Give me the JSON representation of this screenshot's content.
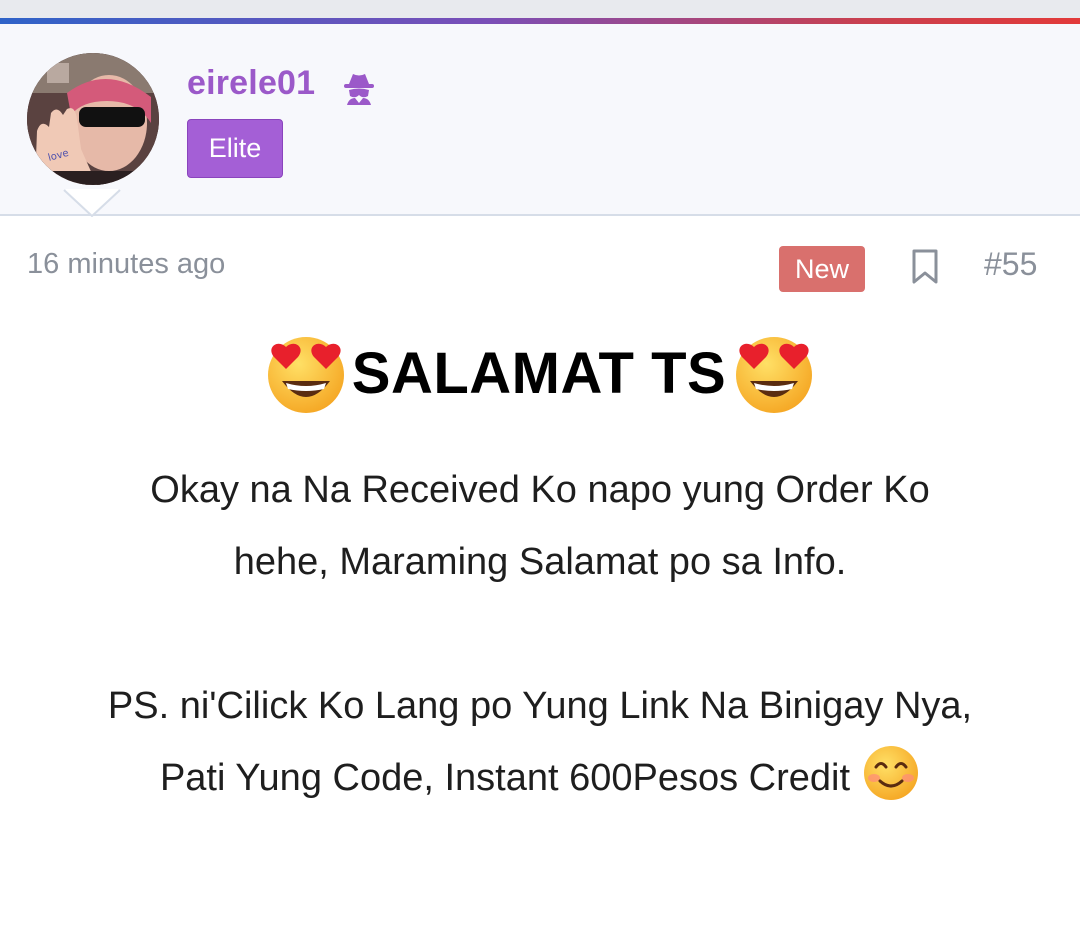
{
  "post": {
    "author": {
      "username": "eirele01",
      "rank_badge": "Elite",
      "username_color": "#9b59c9"
    },
    "time_ago": "16 minutes ago",
    "new_label": "New",
    "post_number": "#55",
    "title": "SALAMAT TS",
    "body": {
      "line1": "Okay na Na Received Ko napo yung Order Ko",
      "line2": "hehe, Maraming Salamat po sa Info.",
      "line3": "PS. ni'Cilick Ko Lang po Yung Link Na Binigay Nya,",
      "line4": "Pati Yung Code, Instant 600Pesos Credit"
    }
  },
  "icons": {
    "author_icon": "spy-icon",
    "bookmark": "bookmark-icon",
    "title_emoji": "heart-eyes-emoji",
    "end_emoji": "smiling-face-emoji"
  },
  "colors": {
    "elite_badge": "#a45fd6",
    "new_badge": "#d9706d",
    "muted_text": "#8a909a",
    "header_bg": "#f7f8fc"
  }
}
